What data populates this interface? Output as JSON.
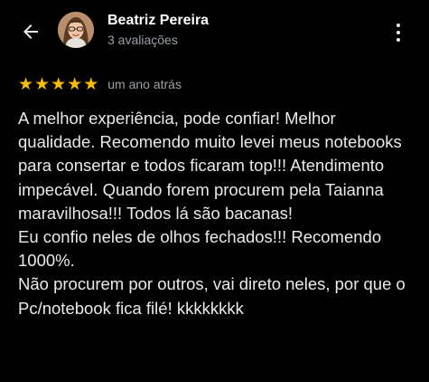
{
  "header": {
    "back_icon": "arrow-left-icon",
    "author_name": "Beatriz Pereira",
    "author_meta": "3 avaliações",
    "more_icon": "more-vertical-icon"
  },
  "review": {
    "rating": 5,
    "rating_max": 5,
    "star_color": "#fbbc04",
    "date": "um ano atrás",
    "paragraphs": [
      "A melhor experiência, pode confiar! Melhor qualidade. Recomendo muito levei meus notebooks para consertar e todos ficaram top!!! Atendimento impecável. Quando forem procurem pela Taianna maravilhosa!!! Todos lá são bacanas!",
      "Eu confio neles de olhos fechados!!! Recomendo 1000%.",
      "Não procurem por outros, vai direto neles, por que o Pc/notebook fica filé! kkkkkkkk"
    ]
  },
  "colors": {
    "background": "#000000",
    "text_primary": "#e8eaed",
    "text_secondary": "#9aa0a6"
  }
}
